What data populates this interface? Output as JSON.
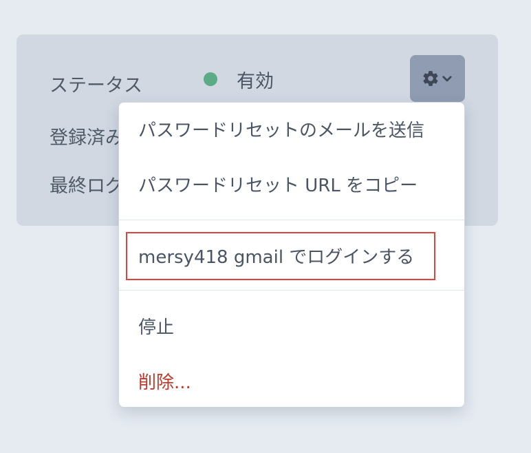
{
  "panel": {
    "rows": [
      {
        "label": "ステータス"
      },
      {
        "label": "登録済み"
      },
      {
        "label": "最終ログ"
      }
    ],
    "status": {
      "value": "有効",
      "dot_color": "#5aab86"
    },
    "settings_button": {
      "icons": [
        "gear-icon",
        "chevron-down-icon"
      ]
    }
  },
  "dropdown": {
    "items": [
      {
        "label": "パスワードリセットのメールを送信"
      },
      {
        "label": "パスワードリセット URL をコピー"
      },
      {
        "label": "mersy418 gmail でログインする",
        "highlighted": true
      },
      {
        "label": "停止"
      },
      {
        "label": "削除...",
        "color": "#c0392b"
      }
    ]
  }
}
